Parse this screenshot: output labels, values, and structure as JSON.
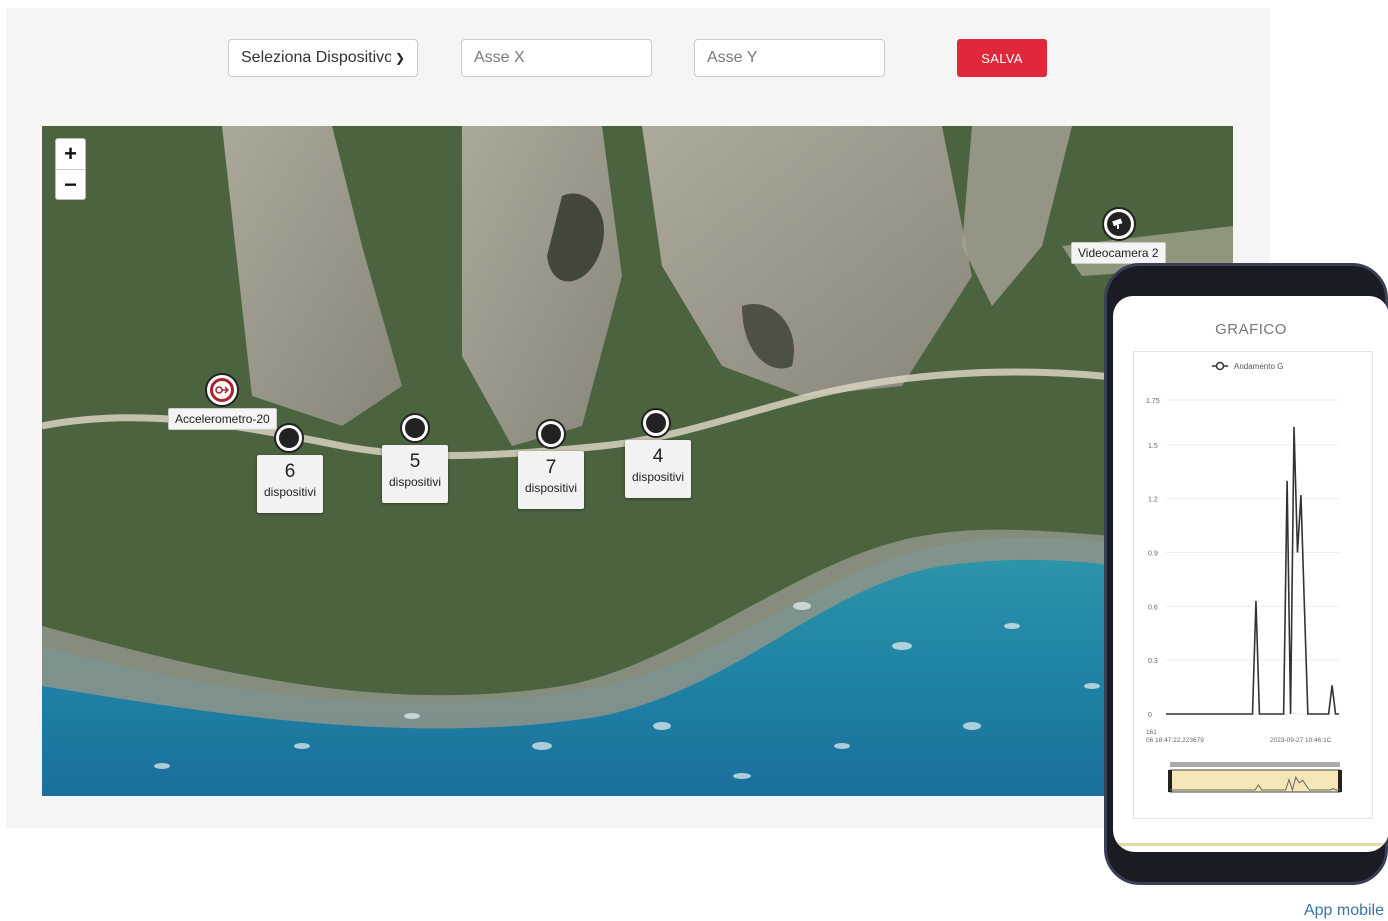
{
  "toolbar": {
    "device_select_value": "Seleziona Dispositivo",
    "axis_x_placeholder": "Asse X",
    "axis_y_placeholder": "Asse Y",
    "save_label": "SALVA",
    "accent_color": "#e0283a"
  },
  "map": {
    "zoom_in_label": "+",
    "zoom_out_label": "−",
    "markers": [
      {
        "label": "Accelerometro-20",
        "icon": "accelerometer-icon"
      },
      {
        "label": "Videocamera 2",
        "icon": "camera-icon"
      }
    ],
    "clusters": [
      {
        "count": "6",
        "text": "dispositivi"
      },
      {
        "count": "5",
        "text": "dispositivi"
      },
      {
        "count": "7",
        "text": "dispositivi"
      },
      {
        "count": "4",
        "text": "dispositivi"
      }
    ]
  },
  "phone": {
    "title": "GRAFICO",
    "legend": "Andamento G",
    "x_start_label": "161\n06 18:47:22.223679",
    "x_end_label": "2023-09-27 10:46:1C"
  },
  "chart_data": {
    "type": "line",
    "title": "GRAFICO",
    "legend": [
      "Andamento G"
    ],
    "y_ticks": [
      0,
      0.3,
      0.6,
      0.9,
      1.2,
      1.5
    ],
    "ylim": [
      0,
      1.75
    ],
    "y_top_label": "1.75",
    "series": [
      {
        "name": "Andamento G",
        "x": [
          0,
          0.5,
          0.52,
          0.54,
          0.68,
          0.7,
          0.72,
          0.74,
          0.76,
          0.78,
          0.8,
          0.82,
          0.9,
          0.94,
          0.96,
          0.98,
          1.0
        ],
        "values": [
          0,
          0,
          0.63,
          0,
          0,
          1.3,
          0,
          1.6,
          0.9,
          1.22,
          0.6,
          0,
          0,
          0,
          0.16,
          0,
          0
        ]
      }
    ]
  },
  "footer": {
    "app_link": "App mobile"
  }
}
